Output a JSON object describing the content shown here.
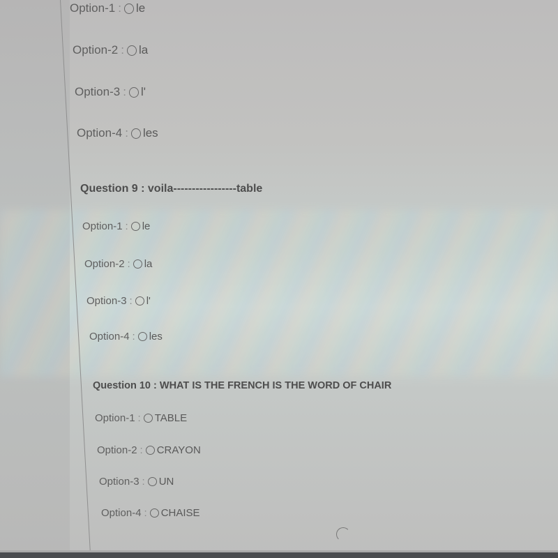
{
  "quiz": {
    "previous_question": {
      "options": [
        {
          "label": "Option-1",
          "text": "le"
        },
        {
          "label": "Option-2",
          "text": "la"
        },
        {
          "label": "Option-3",
          "text": "l'"
        },
        {
          "label": "Option-4",
          "text": "les"
        }
      ]
    },
    "question_9": {
      "title": "Question 9 : voila-----------------table",
      "options": [
        {
          "label": "Option-1",
          "text": "le"
        },
        {
          "label": "Option-2",
          "text": "la"
        },
        {
          "label": "Option-3",
          "text": "l'"
        },
        {
          "label": "Option-4",
          "text": "les"
        }
      ]
    },
    "question_10": {
      "title": "Question 10 : WHAT IS THE FRENCH IS THE WORD OF CHAIR",
      "options": [
        {
          "label": "Option-1",
          "text": "TABLE"
        },
        {
          "label": "Option-2",
          "text": "CRAYON"
        },
        {
          "label": "Option-3",
          "text": "UN"
        },
        {
          "label": "Option-4",
          "text": "CHAISE"
        }
      ]
    },
    "separator": ":",
    "loading_icon": "spinner-icon"
  }
}
